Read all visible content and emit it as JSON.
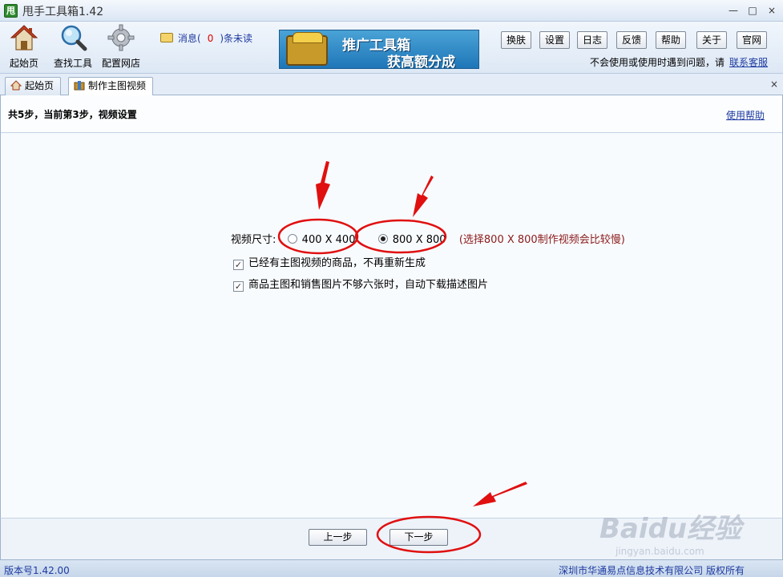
{
  "window": {
    "title": "甩手工具箱1.42",
    "app_icon_text": "甩",
    "minimize": "—",
    "restore": "□",
    "close": "×"
  },
  "toolbar": {
    "home_label": "起始页",
    "find_tool_label": "查找工具",
    "config_store_label": "配置网店",
    "message_prefix": "消息(",
    "message_count": "0",
    "message_suffix": ")条未读",
    "banner_line1": "推广工具箱",
    "banner_line2": "获高额分成",
    "buttons": [
      "换肤",
      "设置",
      "日志",
      "反馈",
      "帮助",
      "关于",
      "官网"
    ],
    "help_text": "不会使用或使用时遇到问题，请",
    "contact_link": "联系客服"
  },
  "tabs": [
    {
      "label": "起始页"
    },
    {
      "label": "制作主图视频"
    }
  ],
  "tab_close": "×",
  "step": {
    "title": "共5步，当前第3步，视频设置",
    "help_link": "使用帮助"
  },
  "settings": {
    "video_size_label": "视频尺寸:",
    "option_400": "400 X 400",
    "option_800": "800 X 800",
    "selected": "800 X 800",
    "note": "(选择800 X 800制作视频会比较慢)",
    "checkbox1": "已经有主图视频的商品，不再重新生成",
    "checkbox2": "商品主图和销售图片不够六张时，自动下载描述图片"
  },
  "nav": {
    "prev": "上一步",
    "next": "下一步"
  },
  "status": {
    "version": "版本号1.42.00",
    "copyright": "深圳市华通易点信息技术有限公司 版权所有"
  },
  "watermark": {
    "brand": "Baidu经验",
    "url": "jingyan.baidu.com"
  },
  "colors": {
    "accent_link": "#1e3aa0",
    "annotation_red": "#e01010",
    "note_text": "#8b1a1a"
  }
}
